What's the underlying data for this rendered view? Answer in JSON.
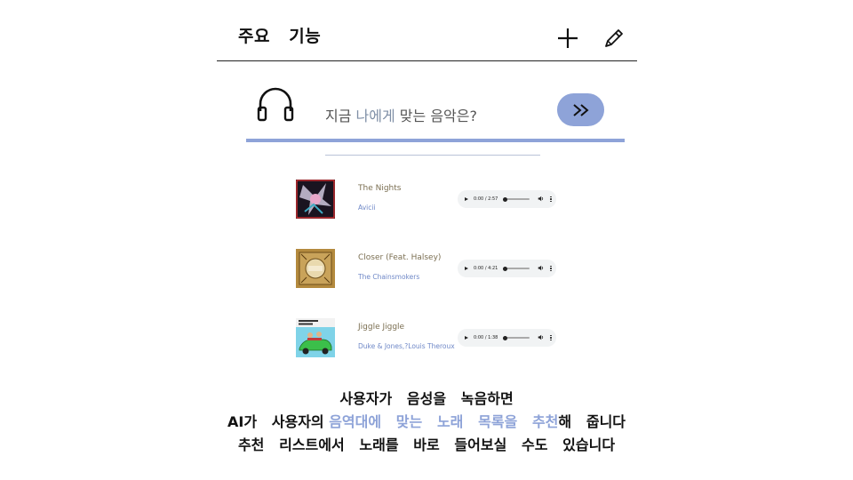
{
  "header": {
    "title": "주요   기능",
    "add_icon": "plus-icon",
    "edit_icon": "pencil-icon"
  },
  "prompt": {
    "icon": "headphones-icon",
    "text_part1": "지금 ",
    "text_accent": "나에게",
    "text_part2": " 맞는 음악은?",
    "go_icon": "double-chevron-right-icon"
  },
  "songs": [
    {
      "title": "The Nights",
      "artist": "Avicii",
      "time": "0:00 / 2:57"
    },
    {
      "title": "Closer (Feat. Halsey)",
      "artist": "The Chainsmokers",
      "time": "0:00 / 4:21"
    },
    {
      "title": "Jiggle Jiggle",
      "artist": "Duke & Jones,?Louis Theroux",
      "time": "0:00 / 1:38"
    }
  ],
  "description": {
    "line1": "사용자가   음성을   녹음하면",
    "line2_a": "AI가   사용자의 ",
    "line2_hl": "음역대에   맞는   노래   목록을   추천",
    "line2_b": "해   줍니다",
    "line3": "추천   리스트에서   노래를   바로   들어보실   수도   있습니다"
  },
  "colors": {
    "accent": "#8ea3d8",
    "artist": "#6f88c7",
    "title": "#7b6f52"
  }
}
